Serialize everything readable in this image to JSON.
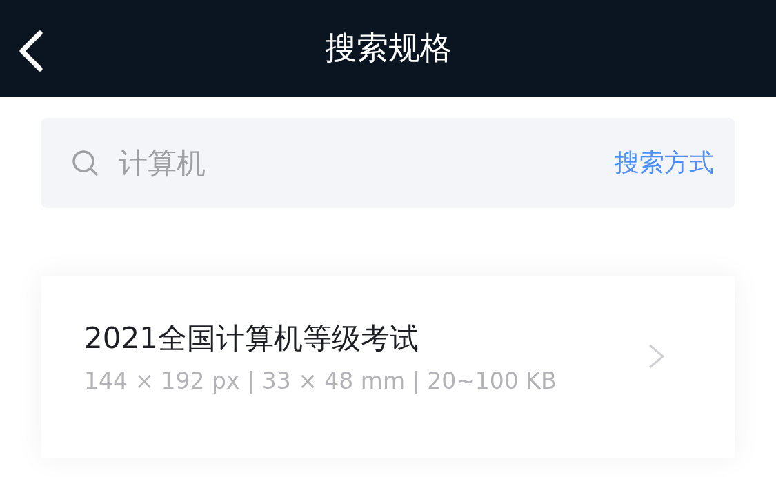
{
  "header": {
    "title": "搜索规格"
  },
  "search": {
    "placeholder": "计算机",
    "mode_link": "搜索方式"
  },
  "results": [
    {
      "title": "2021全国计算机等级考试",
      "spec": "144 × 192 px | 33 × 48 mm | 20~100 KB"
    }
  ]
}
